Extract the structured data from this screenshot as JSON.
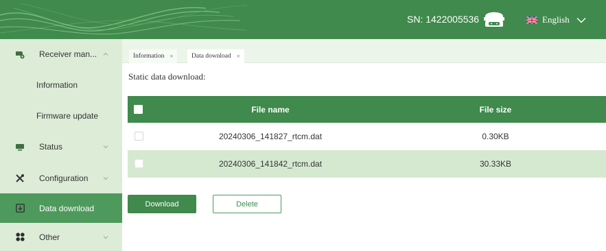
{
  "header": {
    "sn_label": "SN: 1422005536",
    "language": "English",
    "icons": {
      "device": "gnss-receiver-icon",
      "flag": "uk-flag-icon",
      "chevron": "chevron-down-icon"
    }
  },
  "sidebar": {
    "items": [
      {
        "label": "Receiver man...",
        "icon": "receiver-icon",
        "expanded": true
      },
      {
        "label": "Information"
      },
      {
        "label": "Firmware update"
      },
      {
        "label": "Status",
        "icon": "monitor-icon"
      },
      {
        "label": "Configuration",
        "icon": "tools-icon"
      },
      {
        "label": "Data download",
        "icon": "download-icon",
        "active": true
      },
      {
        "label": "Other",
        "icon": "grid-icon"
      }
    ]
  },
  "tabs": [
    {
      "label": "Information",
      "close": "×"
    },
    {
      "label": "Data download",
      "close": "×",
      "active": true
    }
  ],
  "content": {
    "title": "Static data download:",
    "table": {
      "headers": {
        "name": "File name",
        "size": "File size"
      },
      "rows": [
        {
          "name": "20240306_141827_rtcm.dat",
          "size": "0.30KB"
        },
        {
          "name": "20240306_141842_rtcm.dat",
          "size": "30.33KB"
        }
      ]
    },
    "buttons": {
      "download": "Download",
      "delete": "Delete"
    }
  },
  "colors": {
    "primary_green": "#3f8a4c",
    "sidebar_bg": "#dcecd7",
    "active_item": "#4e9a5c",
    "alt_row": "#d5e9d1"
  }
}
